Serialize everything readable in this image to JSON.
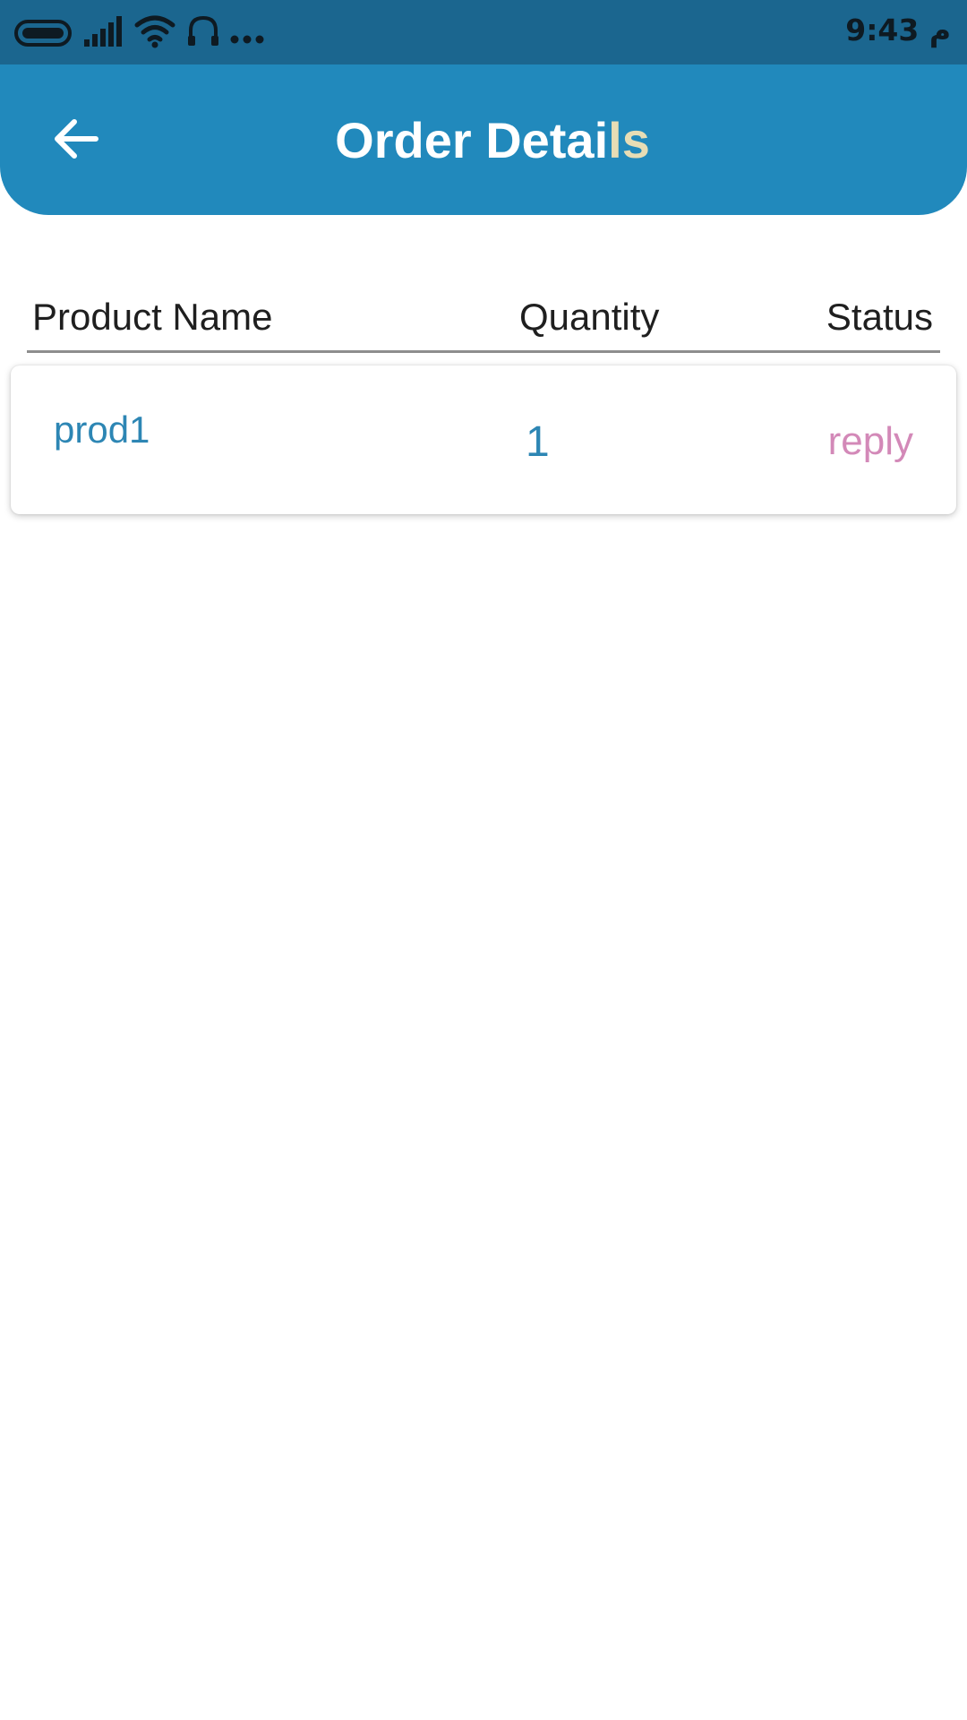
{
  "status_bar": {
    "time": "9:43 م",
    "icons": [
      "battery-icon",
      "signal-icon",
      "wifi-icon",
      "headset-icon",
      "more-icon"
    ]
  },
  "app_bar": {
    "back_icon": "arrow-left-icon",
    "title_main": "Order Detai",
    "title_accent": "ls"
  },
  "table": {
    "headers": [
      "Product Name",
      "Quantity",
      "Status"
    ],
    "rows": [
      {
        "product_name": "prod1",
        "quantity": "1",
        "status": "reply"
      }
    ]
  },
  "colors": {
    "status_bar": "#1b668f",
    "app_bar": "#2189bc",
    "title_accent": "#e7ddb5",
    "row_text": "#2d86b4",
    "status_text": "#d389b8"
  }
}
